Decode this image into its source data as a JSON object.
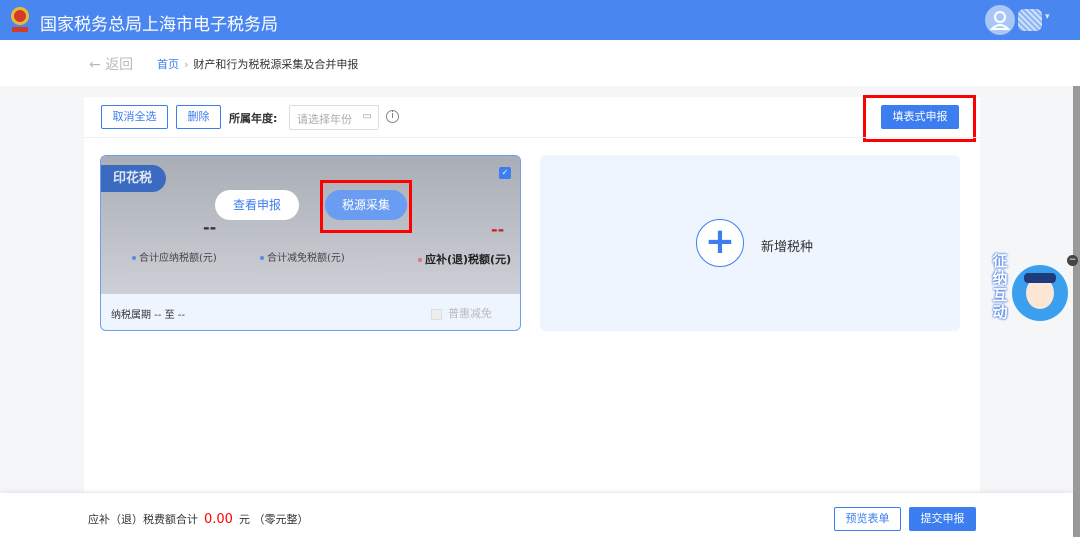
{
  "header": {
    "title": "国家税务总局上海市电子税务局",
    "logo_text": "中国税务"
  },
  "nav": {
    "back": "返回",
    "breadcrumb": [
      "首页",
      "财产和行为税税源采集及合并申报"
    ]
  },
  "toolbar": {
    "deselect_all": "取消全选",
    "delete": "删除",
    "year_label": "所属年度:",
    "year_placeholder": "请选择年份",
    "form_declare": "填表式申报"
  },
  "card": {
    "tax_name": "印花税",
    "checked": true,
    "view_btn": "查看申报",
    "collect_btn": "税源采集",
    "payable_value": "--",
    "payable_label": "合计应纳税额(元)",
    "relief_label": "合计减免税额(元)",
    "refund_value": "--",
    "refund_label": "应补(退)税额(元)",
    "period": "纳税属期 -- 至 --",
    "puhui": "普惠减免"
  },
  "add_card": {
    "label": "新增税种"
  },
  "mascot": {
    "text": "征纳互动"
  },
  "footer": {
    "total_label": "应补（退）税费额合计",
    "amount": "0.00",
    "unit": "元",
    "amount_words": "（零元整）",
    "preview": "预览表单",
    "submit": "提交申报"
  },
  "colors": {
    "brand": "#4a86f0",
    "highlight": "#ff0000",
    "amount": "#ff0000"
  }
}
